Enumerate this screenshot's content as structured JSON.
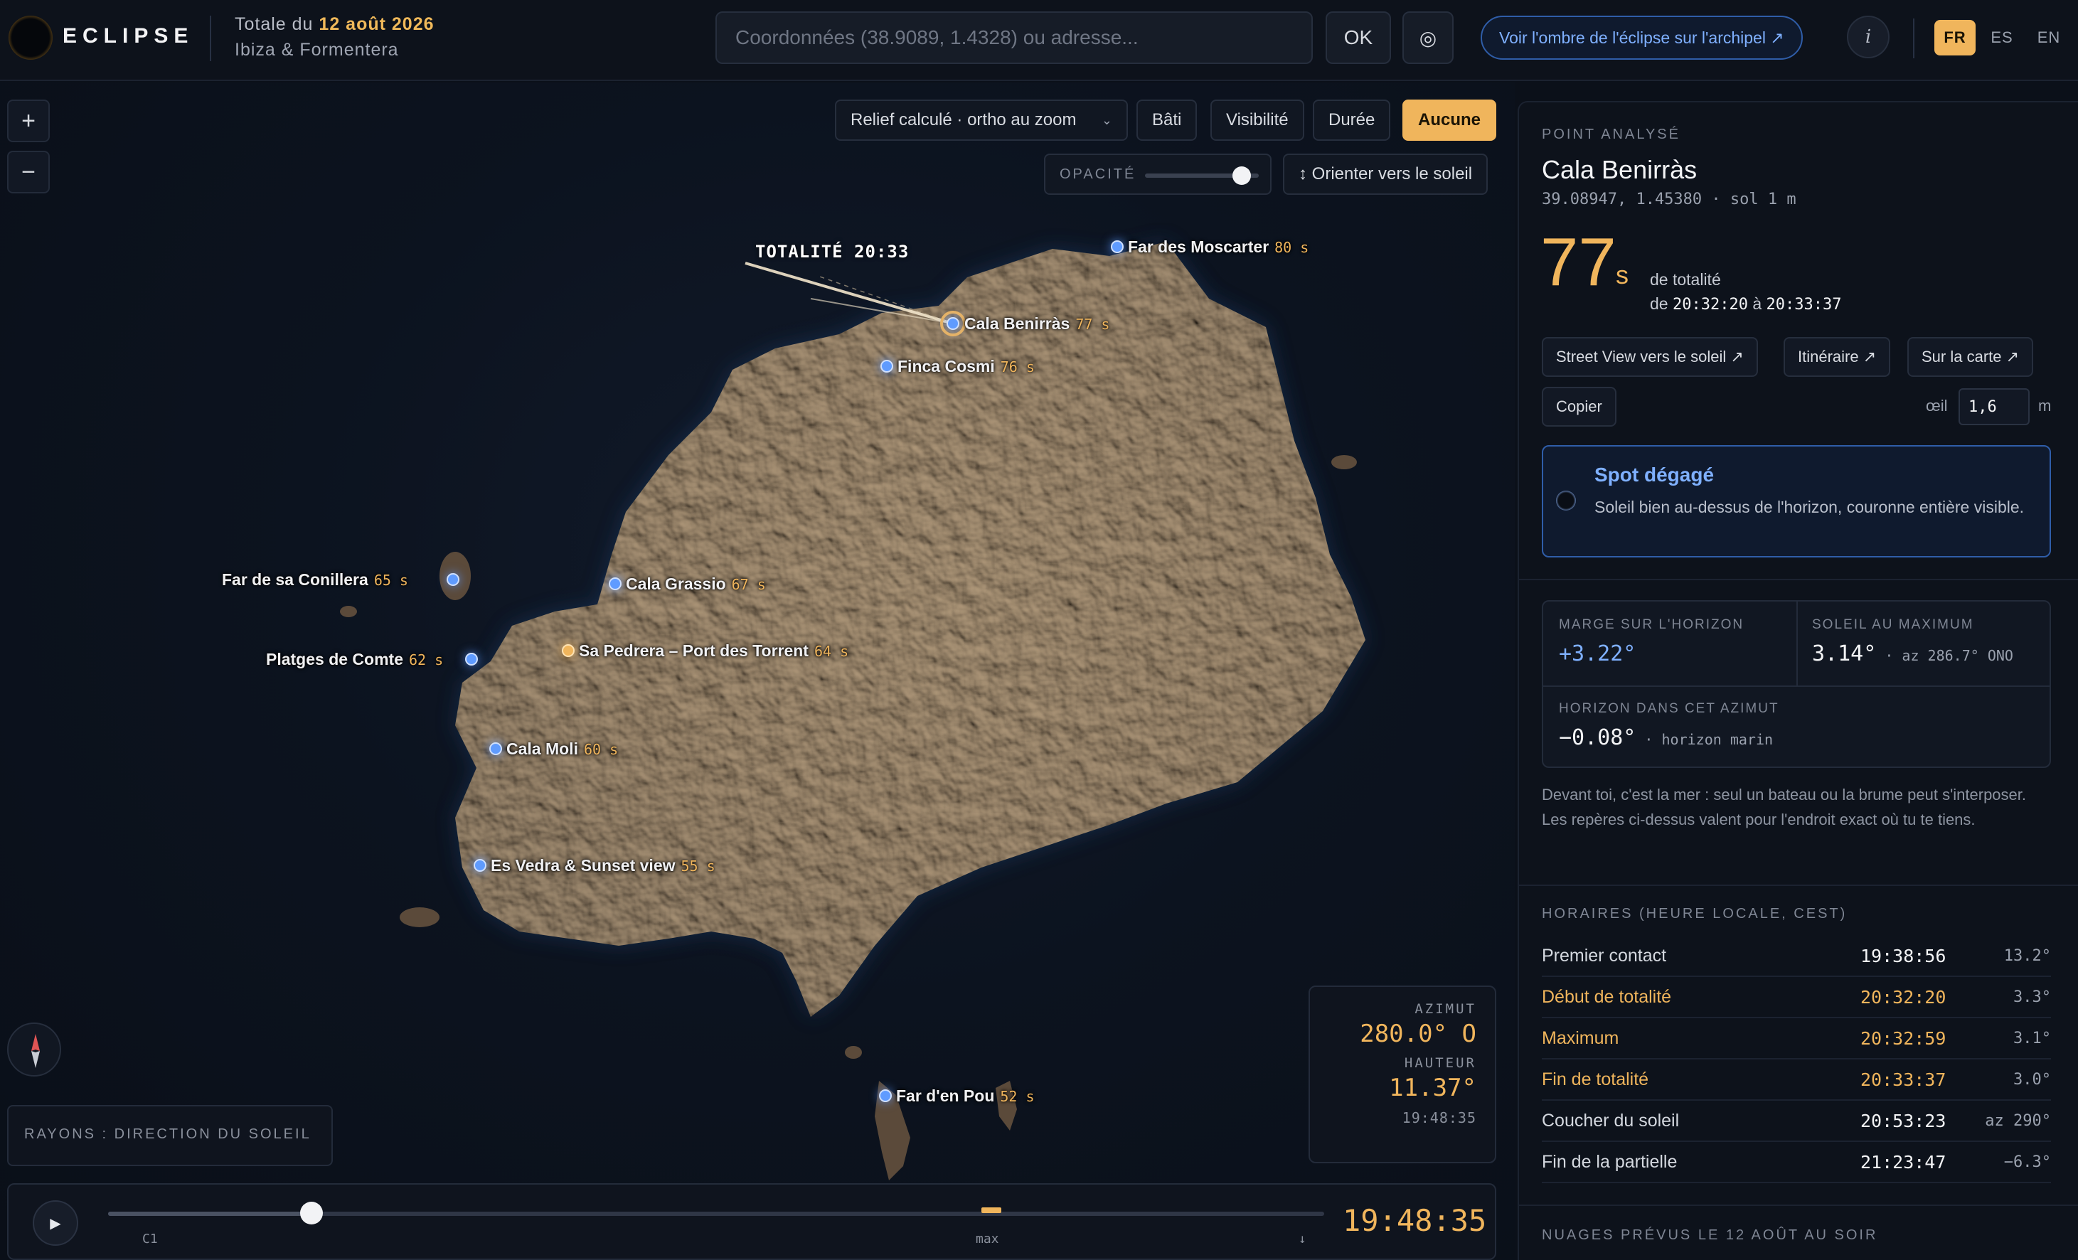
{
  "header": {
    "brand": "ECLIPSE",
    "subtitle_prefix": "Totale du ",
    "subtitle_date": "12 août 2026",
    "subtitle_region": "Ibiza & Formentera",
    "search_placeholder": "Coordonnées (38.9089, 1.4328) ou adresse...",
    "ok_label": "OK",
    "locate_icon": "◎",
    "shadow_link": "Voir l'ombre de l'éclipse sur l'archipel ↗",
    "info_label": "i",
    "languages": [
      "FR",
      "ES",
      "EN"
    ],
    "active_language": "FR"
  },
  "map": {
    "zoom_in": "+",
    "zoom_out": "−",
    "relief_select": "Relief calculé · ortho au zoom",
    "layers": [
      "Bâti",
      "Visibilité",
      "Durée",
      "Aucune"
    ],
    "active_layer": "Aucune",
    "opacity_label": "OPACITÉ",
    "opacity_value": 0.85,
    "orient_label": "↕ Orienter vers le soleil",
    "totalite_label": "TOTALITÉ 20:33",
    "points": [
      {
        "name": "Far des Moscarter",
        "seconds": "80 s"
      },
      {
        "name": "Cala Benirràs",
        "seconds": "77 s"
      },
      {
        "name": "Finca Cosmi",
        "seconds": "76 s"
      },
      {
        "name": "Far de sa Conillera",
        "seconds": "65 s"
      },
      {
        "name": "Cala Grassio",
        "seconds": "67 s"
      },
      {
        "name": "Platges de Comte",
        "seconds": "62 s"
      },
      {
        "name": "Sa Pedrera – Port des Torrent",
        "seconds": "64 s"
      },
      {
        "name": "Cala Moli",
        "seconds": "60 s"
      },
      {
        "name": "Es Vedra & Sunset view",
        "seconds": "55 s"
      },
      {
        "name": "Far d'en Pou",
        "seconds": "52 s"
      }
    ],
    "rays_label": "RAYONS : DIRECTION DU SOLEIL",
    "readout": {
      "azimut_label": "AZIMUT",
      "azimut_value": "280.0° O",
      "hauteur_label": "HAUTEUR",
      "hauteur_value": "11.37°",
      "time": "19:48:35"
    },
    "timeline": {
      "play_icon": "▶",
      "ticks": [
        "C1",
        "max",
        "↓"
      ],
      "progress": 0.167,
      "current_time": "19:48:35"
    }
  },
  "panel": {
    "kicker": "POINT ANALYSÉ",
    "name": "Cala Benirràs",
    "coords": "39.08947, 1.45380 · sol 1 m",
    "duration_number": "77",
    "duration_unit": "s",
    "duration_text": "de totalité",
    "duration_from_prefix": "de ",
    "duration_from": "20:32:20",
    "duration_mid": " à ",
    "duration_to": "20:33:37",
    "buttons": {
      "street_view": "Street View vers le soleil ↗",
      "itineraire": "Itinéraire ↗",
      "sur_la_carte": "Sur la carte ↗",
      "copier": "Copier"
    },
    "eye_label": "œil",
    "eye_value": "1,6",
    "eye_unit": "m",
    "spot": {
      "title": "Spot dégagé",
      "desc": "Soleil bien au-dessus de l'horizon, couronne entière visible."
    },
    "metrics": {
      "marge_label": "MARGE SUR L'HORIZON",
      "marge_value": "+3.22°",
      "soleil_label": "SOLEIL AU MAXIMUM",
      "soleil_value": "3.14°",
      "soleil_az": " · az 286.7° ONO",
      "horizon_label": "HORIZON DANS CET AZIMUT",
      "horizon_value": "−0.08°",
      "horizon_note": " · horizon marin"
    },
    "advice": "Devant toi, c'est la mer : seul un bateau ou la brume peut s'interposer. Les repères ci-dessus valent pour l'endroit exact où tu te tiens.",
    "schedule_title": "HORAIRES (HEURE LOCALE, CEST)",
    "schedule": [
      {
        "name": "Premier contact",
        "time": "19:38:56",
        "angle": "13.2°",
        "highlight": false
      },
      {
        "name": "Début de totalité",
        "time": "20:32:20",
        "angle": "3.3°",
        "highlight": true
      },
      {
        "name": "Maximum",
        "time": "20:32:59",
        "angle": "3.1°",
        "highlight": true
      },
      {
        "name": "Fin de totalité",
        "time": "20:33:37",
        "angle": "3.0°",
        "highlight": true
      },
      {
        "name": "Coucher du soleil",
        "time": "20:53:23",
        "angle": "az 290°",
        "highlight": false
      },
      {
        "name": "Fin de la partielle",
        "time": "21:23:47",
        "angle": "−6.3°",
        "highlight": false
      }
    ],
    "clouds_title": "NUAGES PRÉVUS LE 12 AOÛT AU SOIR"
  },
  "colors": {
    "accent": "#f0b55c",
    "link_blue": "#7fb0ff",
    "background": "#0b1019"
  }
}
